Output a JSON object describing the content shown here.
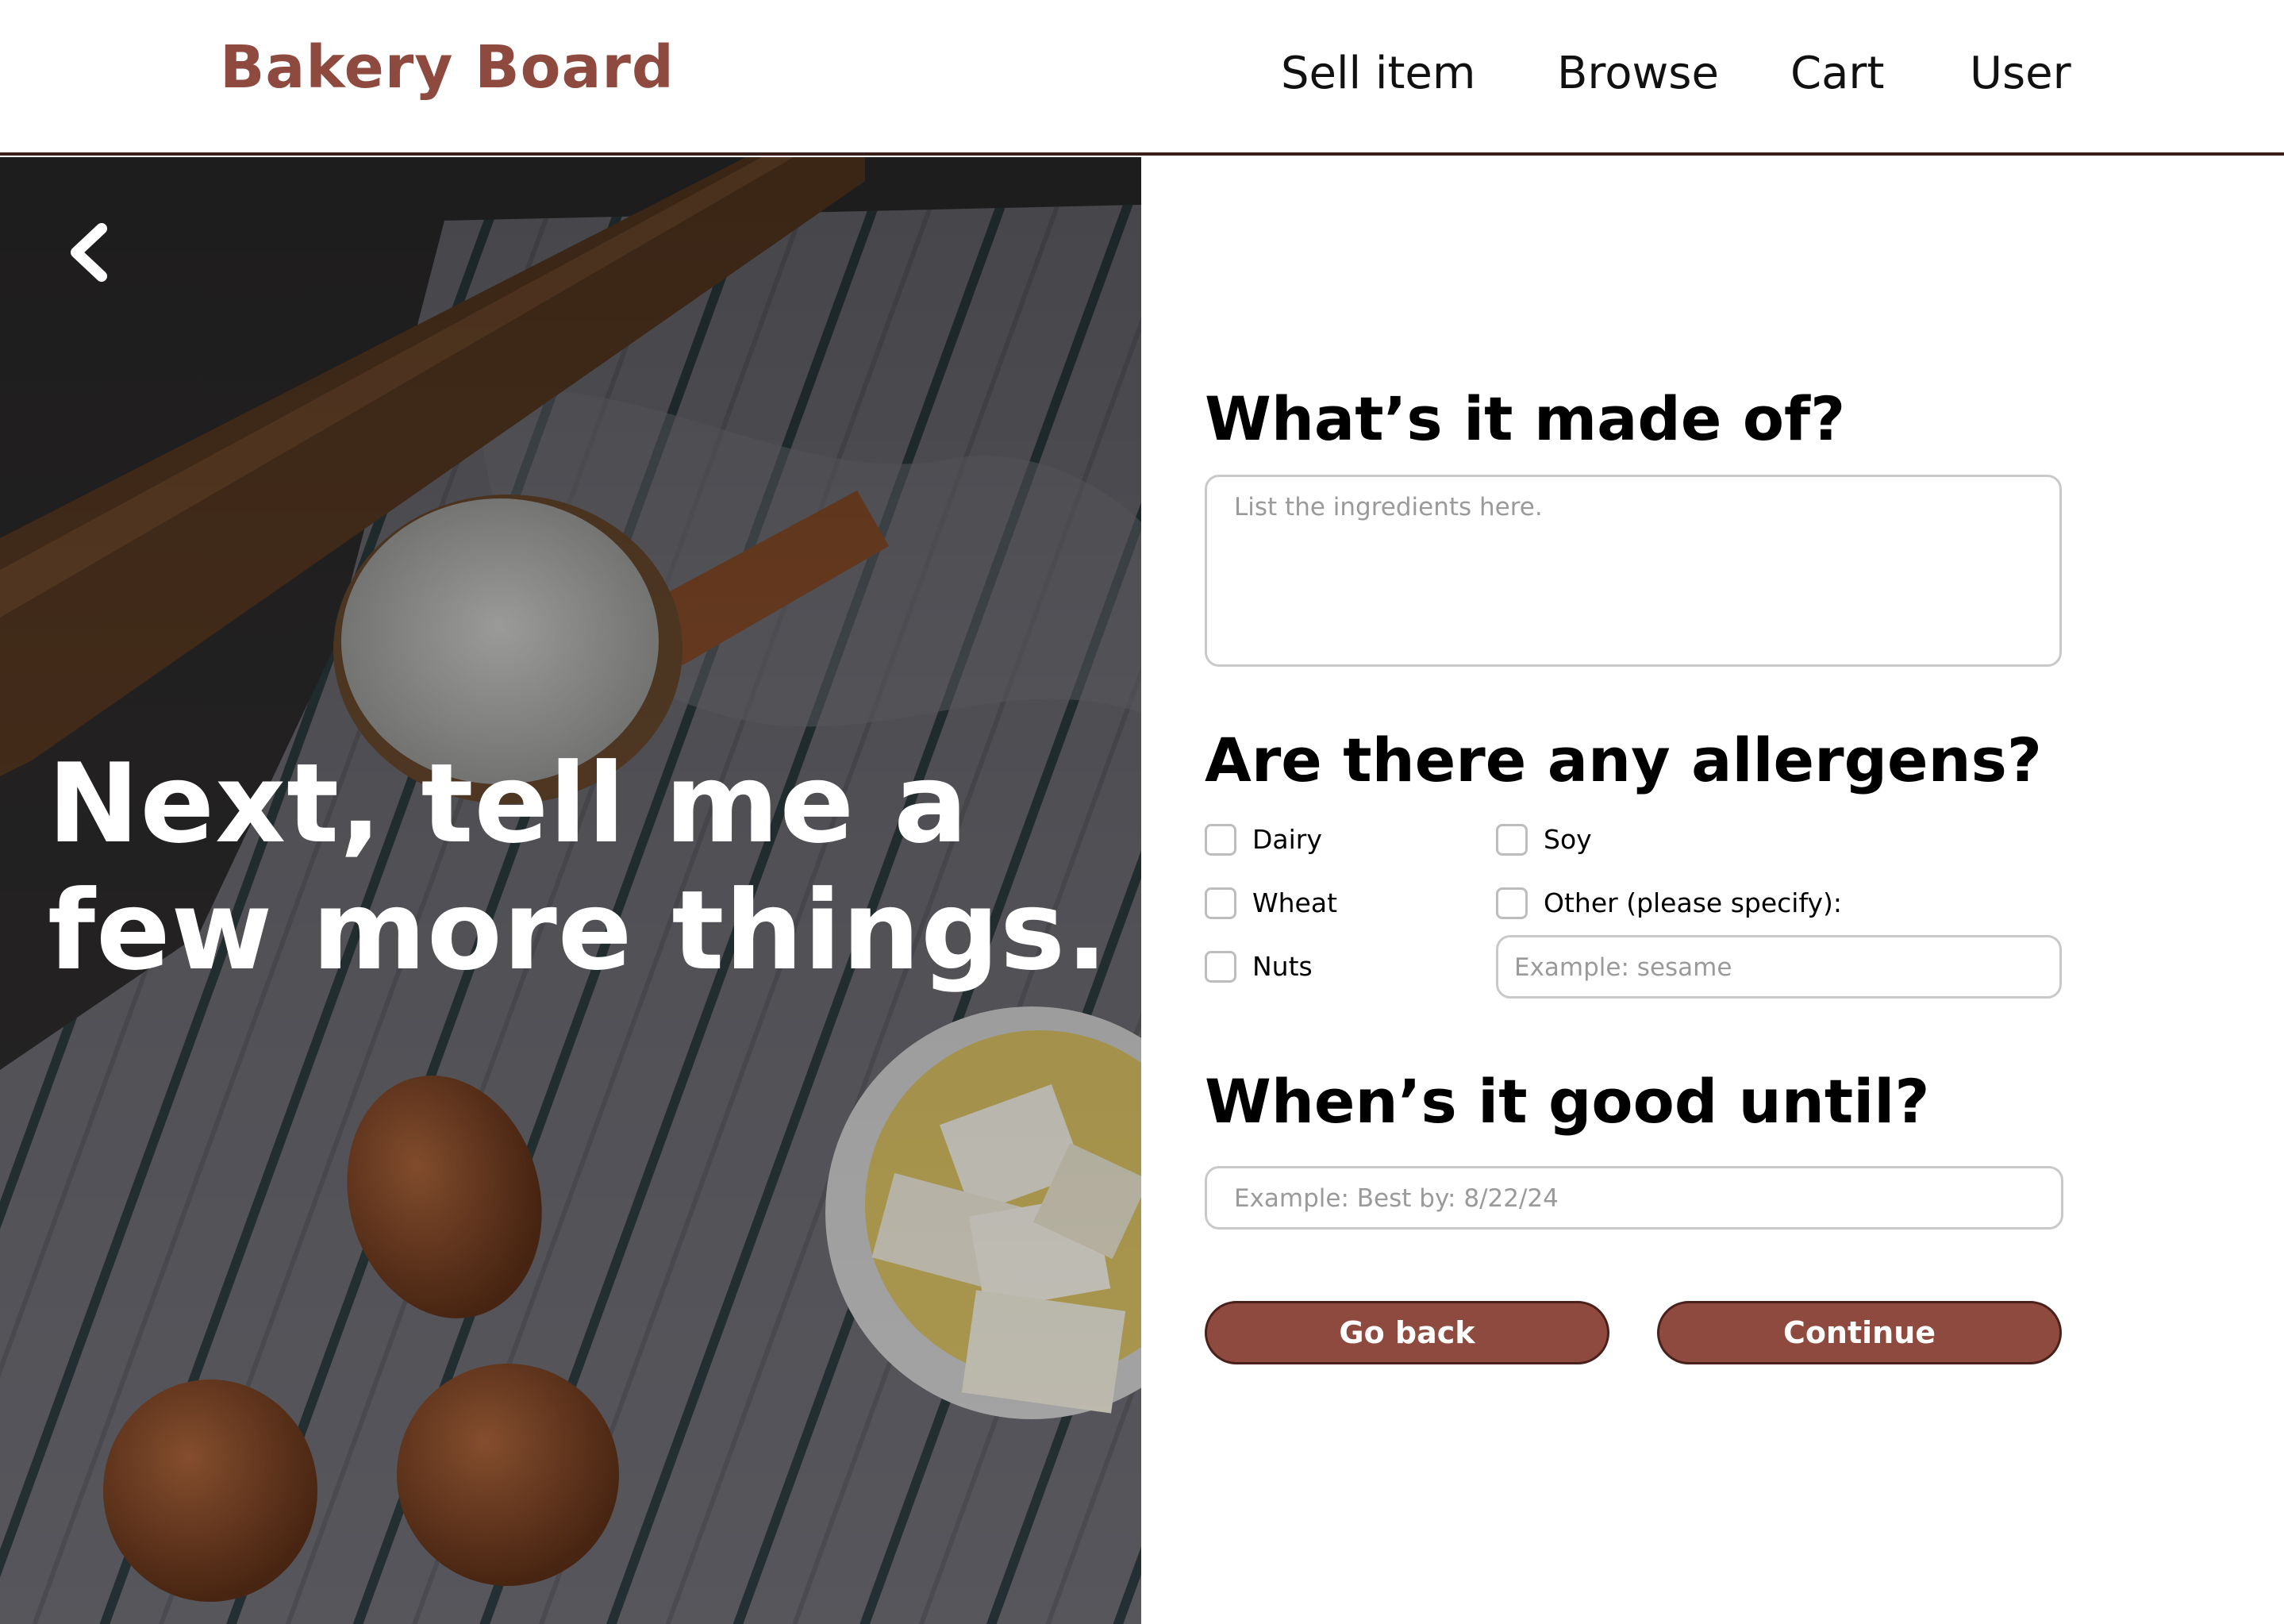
{
  "header": {
    "brand": "Bakery Board",
    "nav": [
      "Sell item",
      "Browse",
      "Cart",
      "User"
    ]
  },
  "hero": {
    "title": "Next, tell me a few more things."
  },
  "form": {
    "ingredients": {
      "title": "What’s it made of?",
      "placeholder": "List the ingredients here."
    },
    "allergens": {
      "title": "Are there any allergens?",
      "options": [
        "Dairy",
        "Wheat",
        "Nuts",
        "Soy",
        "Other (please specify):"
      ],
      "other_placeholder": "Example: sesame"
    },
    "expiry": {
      "title": "When’s it good until?",
      "placeholder": "Example: Best by: 8/22/24"
    },
    "buttons": {
      "back": "Go back",
      "continue": "Continue"
    }
  },
  "colors": {
    "accent": "#8e4a3e",
    "accent_border": "#4a201a",
    "header_border": "#3a1f1a"
  }
}
